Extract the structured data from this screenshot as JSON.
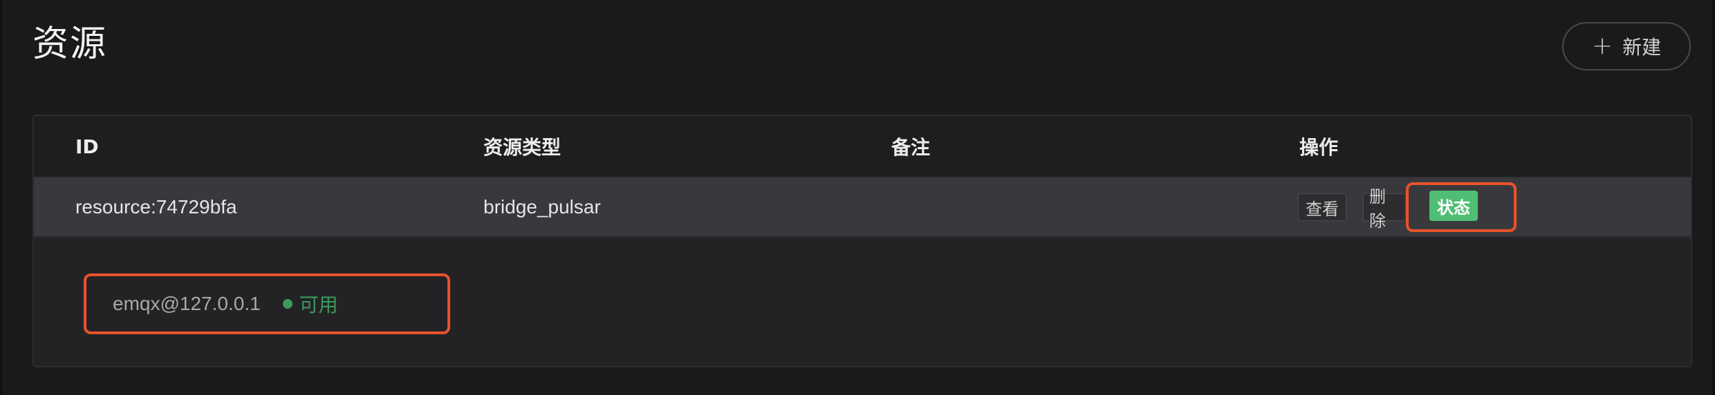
{
  "header": {
    "title": "资源",
    "new_button_label": "新建",
    "new_button_icon": "plus-icon"
  },
  "table": {
    "columns": [
      "ID",
      "资源类型",
      "备注",
      "操作"
    ],
    "rows": [
      {
        "id": "resource:74729bfa",
        "type": "bridge_pulsar",
        "note": "",
        "actions": [
          "查看",
          "删除",
          "状态"
        ]
      }
    ],
    "expanded": {
      "node": "emqx@127.0.0.1",
      "status_label": "可用",
      "status_color": "#3e9a5c"
    }
  },
  "colors": {
    "accent_green": "#4fbe74",
    "highlight_red": "#e8532b"
  }
}
